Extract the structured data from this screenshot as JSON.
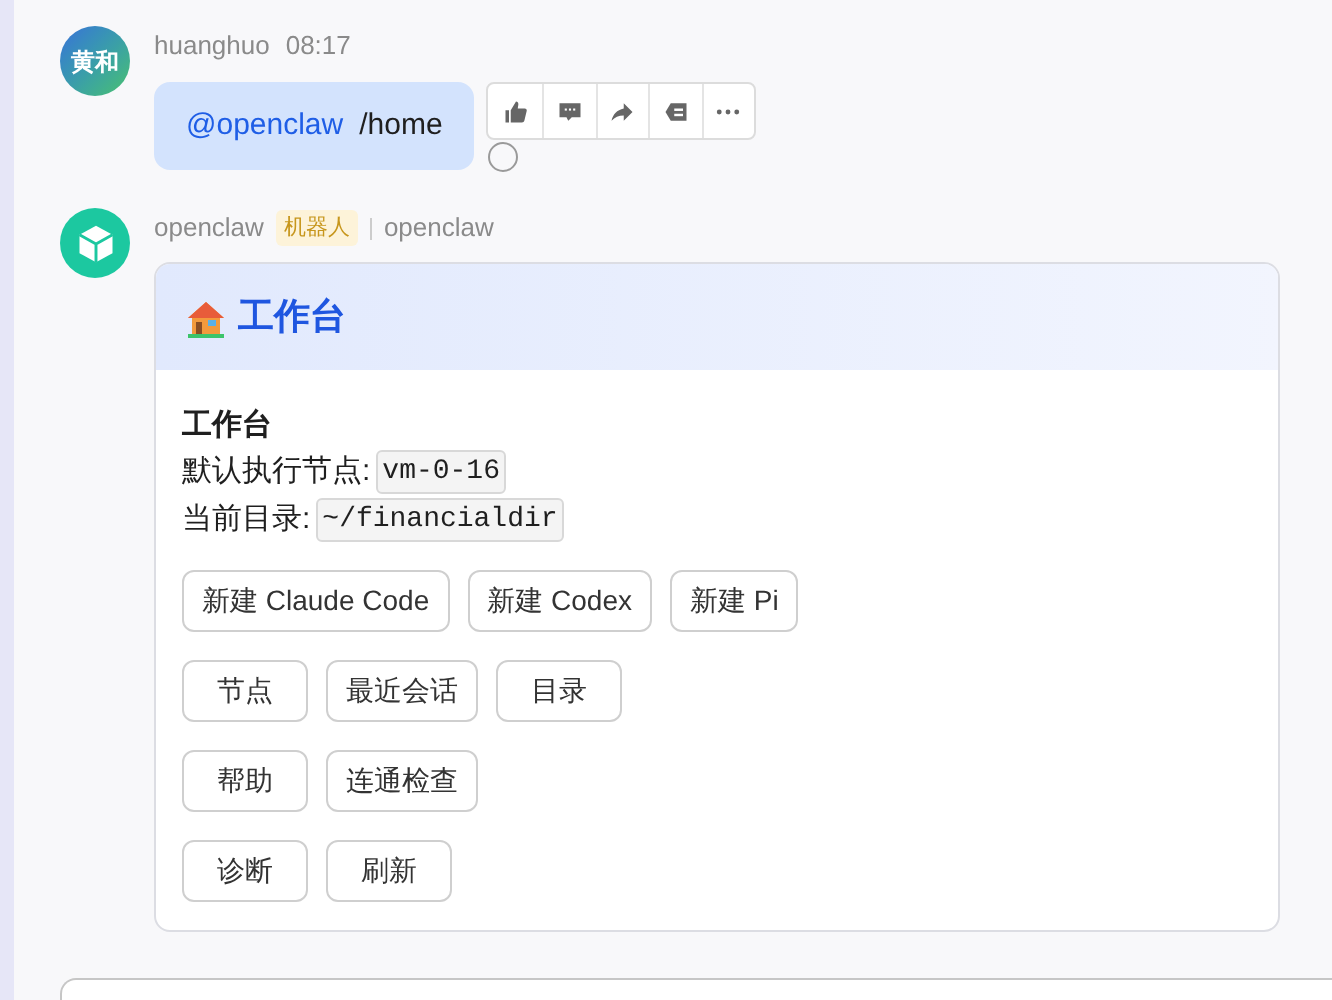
{
  "messages": [
    {
      "kind": "user",
      "avatar": "黄和",
      "sender": "huanghuo",
      "time": "08:17",
      "mention": "@openclaw",
      "text": "/home"
    },
    {
      "kind": "bot",
      "sender": "openclaw",
      "badge": "机器人",
      "source": "openclaw",
      "card": {
        "header": "工作台",
        "title": "工作台",
        "fields": [
          {
            "label": "默认执行节点:",
            "value": "vm-0-16"
          },
          {
            "label": "当前目录:",
            "value": "~/financialdir"
          }
        ],
        "button_rows": [
          [
            "新建 Claude Code",
            "新建 Codex",
            "新建 Pi"
          ],
          [
            "节点",
            "最近会话",
            "目录"
          ],
          [
            "帮助",
            "连通检查"
          ],
          [
            "诊断",
            "刷新"
          ]
        ]
      }
    }
  ]
}
